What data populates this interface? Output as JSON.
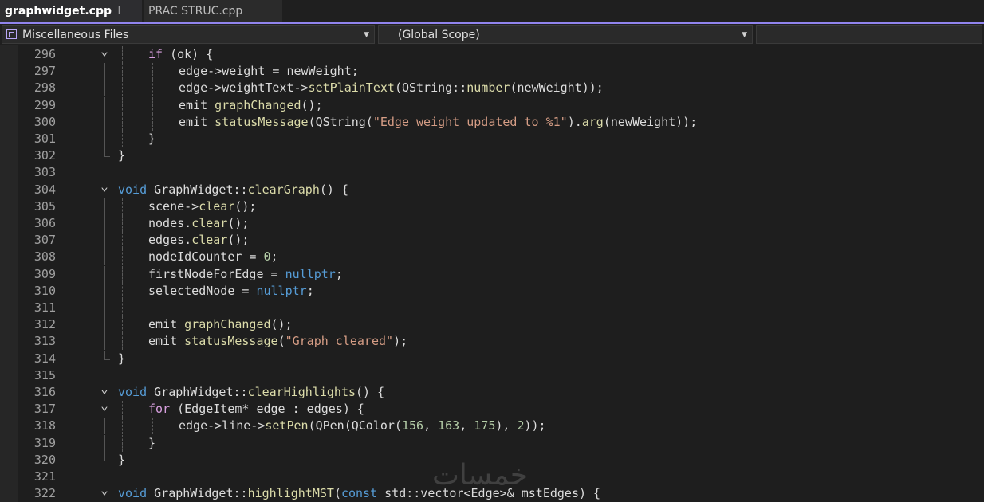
{
  "tabs": [
    {
      "label": "graphwidget.cpp",
      "active": true
    },
    {
      "label": "PRAC STRUC.cpp",
      "active": false
    }
  ],
  "tab_buttons": {
    "pin_glyph": "⊣",
    "close_glyph": "✕"
  },
  "navbar": {
    "project": "Miscellaneous Files",
    "scope": "(Global Scope)",
    "member": ""
  },
  "colors": {
    "accent": "#9184ee",
    "keyword": "#569cd6",
    "control_keyword": "#d8a0df",
    "function": "#dcdcaa",
    "string": "#d69d85",
    "number": "#b5cea8"
  },
  "lines": [
    {
      "n": "296",
      "fold": "open",
      "indent": 2,
      "tokens": [
        [
          "ctl",
          "if"
        ],
        [
          "",
          " (ok) {"
        ]
      ]
    },
    {
      "n": "297",
      "indent": 3,
      "tokens": [
        [
          "",
          "edge->weight = newWeight;"
        ]
      ]
    },
    {
      "n": "298",
      "indent": 3,
      "tokens": [
        [
          "",
          "edge->weightText->"
        ],
        [
          "fn",
          "setPlainText"
        ],
        [
          "",
          "(QString::"
        ],
        [
          "fn",
          "number"
        ],
        [
          "",
          "(newWeight));"
        ]
      ]
    },
    {
      "n": "299",
      "indent": 3,
      "tokens": [
        [
          "",
          "emit "
        ],
        [
          "fn",
          "graphChanged"
        ],
        [
          "",
          "();"
        ]
      ]
    },
    {
      "n": "300",
      "indent": 3,
      "tokens": [
        [
          "",
          "emit "
        ],
        [
          "fn",
          "statusMessage"
        ],
        [
          "",
          "(QString("
        ],
        [
          "str",
          "\"Edge weight updated to %1\""
        ],
        [
          "",
          ")."
        ],
        [
          "fn",
          "arg"
        ],
        [
          "",
          "(newWeight));"
        ]
      ]
    },
    {
      "n": "301",
      "indent": 2,
      "tokens": [
        [
          "",
          "}"
        ]
      ]
    },
    {
      "n": "302",
      "indent": 1,
      "foldend": true,
      "tokens": [
        [
          "",
          "}"
        ]
      ]
    },
    {
      "n": "303",
      "indent": 0,
      "tokens": []
    },
    {
      "n": "304",
      "fold": "open",
      "indent": 1,
      "tokens": [
        [
          "kw",
          "void"
        ],
        [
          "",
          " GraphWidget::"
        ],
        [
          "fn",
          "clearGraph"
        ],
        [
          "",
          "() {"
        ]
      ]
    },
    {
      "n": "305",
      "indent": 2,
      "tokens": [
        [
          "",
          "scene->"
        ],
        [
          "fn",
          "clear"
        ],
        [
          "",
          "();"
        ]
      ]
    },
    {
      "n": "306",
      "indent": 2,
      "tokens": [
        [
          "",
          "nodes."
        ],
        [
          "fn",
          "clear"
        ],
        [
          "",
          "();"
        ]
      ]
    },
    {
      "n": "307",
      "indent": 2,
      "tokens": [
        [
          "",
          "edges."
        ],
        [
          "fn",
          "clear"
        ],
        [
          "",
          "();"
        ]
      ]
    },
    {
      "n": "308",
      "indent": 2,
      "tokens": [
        [
          "",
          "nodeIdCounter = "
        ],
        [
          "num",
          "0"
        ],
        [
          "",
          ";"
        ]
      ]
    },
    {
      "n": "309",
      "indent": 2,
      "tokens": [
        [
          "",
          "firstNodeForEdge = "
        ],
        [
          "kw",
          "nullptr"
        ],
        [
          "",
          ";"
        ]
      ]
    },
    {
      "n": "310",
      "indent": 2,
      "tokens": [
        [
          "",
          "selectedNode = "
        ],
        [
          "kw",
          "nullptr"
        ],
        [
          "",
          ";"
        ]
      ]
    },
    {
      "n": "311",
      "indent": 2,
      "tokens": []
    },
    {
      "n": "312",
      "indent": 2,
      "tokens": [
        [
          "",
          "emit "
        ],
        [
          "fn",
          "graphChanged"
        ],
        [
          "",
          "();"
        ]
      ]
    },
    {
      "n": "313",
      "indent": 2,
      "tokens": [
        [
          "",
          "emit "
        ],
        [
          "fn",
          "statusMessage"
        ],
        [
          "",
          "("
        ],
        [
          "str",
          "\"Graph cleared\""
        ],
        [
          "",
          ");"
        ]
      ]
    },
    {
      "n": "314",
      "indent": 1,
      "foldend": true,
      "tokens": [
        [
          "",
          "}"
        ]
      ]
    },
    {
      "n": "315",
      "indent": 0,
      "tokens": []
    },
    {
      "n": "316",
      "fold": "open",
      "indent": 1,
      "tokens": [
        [
          "kw",
          "void"
        ],
        [
          "",
          " GraphWidget::"
        ],
        [
          "fn",
          "clearHighlights"
        ],
        [
          "",
          "() {"
        ]
      ]
    },
    {
      "n": "317",
      "fold": "open",
      "indent": 2,
      "tokens": [
        [
          "ctl",
          "for"
        ],
        [
          "",
          " (EdgeItem* edge : edges) {"
        ]
      ]
    },
    {
      "n": "318",
      "indent": 3,
      "tokens": [
        [
          "",
          "edge->line->"
        ],
        [
          "fn",
          "setPen"
        ],
        [
          "",
          "(QPen(QColor("
        ],
        [
          "num",
          "156"
        ],
        [
          "",
          ", "
        ],
        [
          "num",
          "163"
        ],
        [
          "",
          ", "
        ],
        [
          "num",
          "175"
        ],
        [
          "",
          "), "
        ],
        [
          "num",
          "2"
        ],
        [
          "",
          "));"
        ]
      ]
    },
    {
      "n": "319",
      "indent": 2,
      "tokens": [
        [
          "",
          "}"
        ]
      ]
    },
    {
      "n": "320",
      "indent": 1,
      "foldend": true,
      "tokens": [
        [
          "",
          "}"
        ]
      ]
    },
    {
      "n": "321",
      "indent": 0,
      "tokens": []
    },
    {
      "n": "322",
      "fold": "open",
      "indent": 1,
      "tokens": [
        [
          "kw",
          "void"
        ],
        [
          "",
          " GraphWidget::"
        ],
        [
          "fn",
          "highlightMST"
        ],
        [
          "",
          "("
        ],
        [
          "kw",
          "const"
        ],
        [
          "",
          " std::vector<Edge>& mstEdges) {"
        ]
      ]
    }
  ],
  "watermark": "خمسات"
}
